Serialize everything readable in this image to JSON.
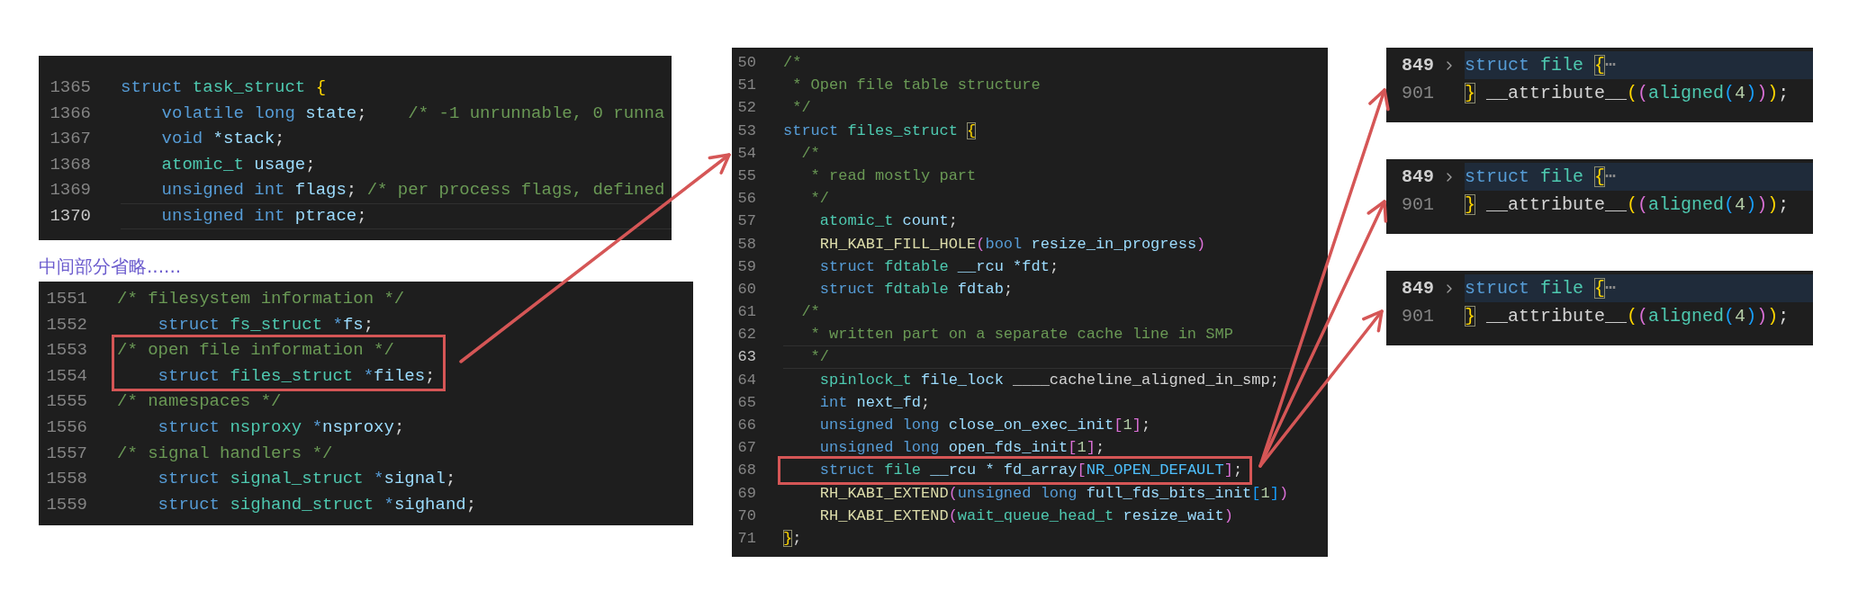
{
  "snippets": [
    {
      "lines": [
        {
          "number": "1365",
          "current": false,
          "boxed": false,
          "tokens": [
            {
              "text": "struct",
              "kind": "keyword"
            },
            {
              "text": " task_struct",
              "kind": "type"
            },
            {
              "text": " {",
              "kind": "bracket_gold"
            }
          ]
        },
        {
          "number": "1366",
          "current": false,
          "boxed": false,
          "tokens": [
            {
              "text": "    volatile long",
              "kind": "keyword"
            },
            {
              "text": " state",
              "kind": "variable"
            },
            {
              "text": ";",
              "kind": "punct"
            },
            {
              "text": "    /* -1 unrunnable, 0 runna",
              "kind": "comment"
            }
          ]
        },
        {
          "number": "1367",
          "current": false,
          "boxed": false,
          "tokens": [
            {
              "text": "    void",
              "kind": "keyword"
            },
            {
              "text": " *stack",
              "kind": "variable"
            },
            {
              "text": ";",
              "kind": "punct"
            }
          ]
        },
        {
          "number": "1368",
          "current": false,
          "boxed": false,
          "tokens": [
            {
              "text": "    atomic_t",
              "kind": "type"
            },
            {
              "text": " usage",
              "kind": "variable"
            },
            {
              "text": ";",
              "kind": "punct"
            }
          ]
        },
        {
          "number": "1369",
          "current": false,
          "boxed": false,
          "tokens": [
            {
              "text": "    unsigned int",
              "kind": "keyword"
            },
            {
              "text": " flags",
              "kind": "variable"
            },
            {
              "text": ";",
              "kind": "punct"
            },
            {
              "text": " /* per process flags, defined",
              "kind": "comment"
            }
          ]
        },
        {
          "number": "1370",
          "current": true,
          "boxed": false,
          "tokens": [
            {
              "text": "    unsigned int",
              "kind": "keyword"
            },
            {
              "text": " ptrace",
              "kind": "variable"
            },
            {
              "text": ";",
              "kind": "punct"
            }
          ]
        }
      ]
    },
    {
      "lines": [
        {
          "number": "1551",
          "current": false,
          "boxed": false,
          "tokens": [
            {
              "text": "/* filesystem information */",
              "kind": "comment"
            }
          ]
        },
        {
          "number": "1552",
          "current": false,
          "boxed": false,
          "tokens": [
            {
              "text": "    struct",
              "kind": "keyword"
            },
            {
              "text": " fs_struct",
              "kind": "type"
            },
            {
              "text": " *",
              "kind": "keyword"
            },
            {
              "text": "fs",
              "kind": "variable"
            },
            {
              "text": ";",
              "kind": "punct"
            }
          ]
        },
        {
          "number": "1553",
          "current": false,
          "boxed": true,
          "tokens": [
            {
              "text": "/* open file information */",
              "kind": "comment"
            }
          ]
        },
        {
          "number": "1554",
          "current": false,
          "boxed": true,
          "tokens": [
            {
              "text": "    struct",
              "kind": "keyword"
            },
            {
              "text": " files_struct",
              "kind": "type"
            },
            {
              "text": " *",
              "kind": "keyword"
            },
            {
              "text": "files",
              "kind": "variable"
            },
            {
              "text": ";",
              "kind": "punct"
            }
          ]
        },
        {
          "number": "1555",
          "current": false,
          "boxed": false,
          "tokens": [
            {
              "text": "/* namespaces */",
              "kind": "comment"
            }
          ]
        },
        {
          "number": "1556",
          "current": false,
          "boxed": false,
          "tokens": [
            {
              "text": "    struct",
              "kind": "keyword"
            },
            {
              "text": " nsproxy",
              "kind": "type"
            },
            {
              "text": " *",
              "kind": "keyword"
            },
            {
              "text": "nsproxy",
              "kind": "variable"
            },
            {
              "text": ";",
              "kind": "punct"
            }
          ]
        },
        {
          "number": "1557",
          "current": false,
          "boxed": false,
          "tokens": [
            {
              "text": "/* signal handlers */",
              "kind": "comment"
            }
          ]
        },
        {
          "number": "1558",
          "current": false,
          "boxed": false,
          "tokens": [
            {
              "text": "    struct",
              "kind": "keyword"
            },
            {
              "text": " signal_struct",
              "kind": "type"
            },
            {
              "text": " *",
              "kind": "keyword"
            },
            {
              "text": "signal",
              "kind": "variable"
            },
            {
              "text": ";",
              "kind": "punct"
            }
          ]
        },
        {
          "number": "1559",
          "current": false,
          "boxed": false,
          "tokens": [
            {
              "text": "    struct",
              "kind": "keyword"
            },
            {
              "text": " sighand_struct",
              "kind": "type"
            },
            {
              "text": " *",
              "kind": "keyword"
            },
            {
              "text": "sighand",
              "kind": "variable"
            },
            {
              "text": ";",
              "kind": "punct"
            }
          ]
        }
      ]
    },
    {
      "lines": [
        {
          "number": "50",
          "current": false,
          "boxed": false,
          "tokens": [
            {
              "text": "/*",
              "kind": "comment"
            }
          ]
        },
        {
          "number": "51",
          "current": false,
          "boxed": false,
          "tokens": [
            {
              "text": " * Open file table structure",
              "kind": "comment"
            }
          ]
        },
        {
          "number": "52",
          "current": false,
          "boxed": false,
          "tokens": [
            {
              "text": " */",
              "kind": "comment"
            }
          ]
        },
        {
          "number": "53",
          "current": false,
          "boxed": false,
          "tokens": [
            {
              "text": "struct",
              "kind": "keyword"
            },
            {
              "text": " files_struct ",
              "kind": "type"
            },
            {
              "text": "{",
              "kind": "bracket_match"
            }
          ]
        },
        {
          "number": "54",
          "current": false,
          "boxed": false,
          "tokens": [
            {
              "text": "  /*",
              "kind": "comment"
            }
          ]
        },
        {
          "number": "55",
          "current": false,
          "boxed": false,
          "tokens": [
            {
              "text": "   * read mostly part",
              "kind": "comment"
            }
          ]
        },
        {
          "number": "56",
          "current": false,
          "boxed": false,
          "tokens": [
            {
              "text": "   */",
              "kind": "comment"
            }
          ]
        },
        {
          "number": "57",
          "current": false,
          "boxed": false,
          "tokens": [
            {
              "text": "    atomic_t",
              "kind": "type"
            },
            {
              "text": " count",
              "kind": "variable"
            },
            {
              "text": ";",
              "kind": "punct"
            }
          ]
        },
        {
          "number": "58",
          "current": false,
          "boxed": false,
          "tokens": [
            {
              "text": "    RH_KABI_FILL_HOLE",
              "kind": "macro"
            },
            {
              "text": "(",
              "kind": "bracket_pink"
            },
            {
              "text": "bool",
              "kind": "keyword"
            },
            {
              "text": " resize_in_progress",
              "kind": "variable"
            },
            {
              "text": ")",
              "kind": "bracket_pink"
            }
          ]
        },
        {
          "number": "59",
          "current": false,
          "boxed": false,
          "tokens": [
            {
              "text": "    struct",
              "kind": "keyword"
            },
            {
              "text": " fdtable",
              "kind": "type"
            },
            {
              "text": " __rcu *fdt",
              "kind": "variable"
            },
            {
              "text": ";",
              "kind": "punct"
            }
          ]
        },
        {
          "number": "60",
          "current": false,
          "boxed": false,
          "tokens": [
            {
              "text": "    struct",
              "kind": "keyword"
            },
            {
              "text": " fdtable",
              "kind": "type"
            },
            {
              "text": " fdtab",
              "kind": "variable"
            },
            {
              "text": ";",
              "kind": "punct"
            }
          ]
        },
        {
          "number": "61",
          "current": false,
          "boxed": false,
          "tokens": [
            {
              "text": "  /*",
              "kind": "comment"
            }
          ]
        },
        {
          "number": "62",
          "current": false,
          "boxed": false,
          "tokens": [
            {
              "text": "   * written part on a separate cache line in SMP",
              "kind": "comment"
            }
          ]
        },
        {
          "number": "63",
          "current": true,
          "boxed": false,
          "tokens": [
            {
              "text": "   */",
              "kind": "comment"
            }
          ]
        },
        {
          "number": "64",
          "current": false,
          "boxed": false,
          "tokens": [
            {
              "text": "    spinlock_t",
              "kind": "type"
            },
            {
              "text": " file_lock",
              "kind": "variable"
            },
            {
              "text": " ____cacheline_aligned_in_smp",
              "kind": "plain"
            },
            {
              "text": ";",
              "kind": "punct"
            }
          ]
        },
        {
          "number": "65",
          "current": false,
          "boxed": false,
          "tokens": [
            {
              "text": "    int",
              "kind": "keyword"
            },
            {
              "text": " next_fd",
              "kind": "variable"
            },
            {
              "text": ";",
              "kind": "punct"
            }
          ]
        },
        {
          "number": "66",
          "current": false,
          "boxed": false,
          "tokens": [
            {
              "text": "    unsigned long",
              "kind": "keyword"
            },
            {
              "text": " close_on_exec_init",
              "kind": "variable"
            },
            {
              "text": "[",
              "kind": "bracket_pink"
            },
            {
              "text": "1",
              "kind": "number"
            },
            {
              "text": "]",
              "kind": "bracket_pink"
            },
            {
              "text": ";",
              "kind": "punct"
            }
          ]
        },
        {
          "number": "67",
          "current": false,
          "boxed": false,
          "tokens": [
            {
              "text": "    unsigned long",
              "kind": "keyword"
            },
            {
              "text": " open_fds_init",
              "kind": "variable"
            },
            {
              "text": "[",
              "kind": "bracket_pink"
            },
            {
              "text": "1",
              "kind": "number"
            },
            {
              "text": "]",
              "kind": "bracket_pink"
            },
            {
              "text": ";",
              "kind": "punct"
            }
          ]
        },
        {
          "number": "68",
          "current": false,
          "boxed": true,
          "tokens": [
            {
              "text": "    struct",
              "kind": "keyword"
            },
            {
              "text": " file",
              "kind": "type"
            },
            {
              "text": " __rcu * fd_array",
              "kind": "variable"
            },
            {
              "text": "[",
              "kind": "bracket_pink"
            },
            {
              "text": "NR_OPEN_DEFAULT",
              "kind": "const"
            },
            {
              "text": "]",
              "kind": "bracket_pink"
            },
            {
              "text": ";",
              "kind": "punct"
            }
          ]
        },
        {
          "number": "69",
          "current": false,
          "boxed": false,
          "tokens": [
            {
              "text": "    RH_KABI_EXTEND",
              "kind": "macro"
            },
            {
              "text": "(",
              "kind": "bracket_pink"
            },
            {
              "text": "unsigned long",
              "kind": "keyword"
            },
            {
              "text": " full_fds_bits_init",
              "kind": "variable"
            },
            {
              "text": "[",
              "kind": "bracket_blue"
            },
            {
              "text": "1",
              "kind": "number"
            },
            {
              "text": "]",
              "kind": "bracket_blue"
            },
            {
              "text": ")",
              "kind": "bracket_pink"
            }
          ]
        },
        {
          "number": "70",
          "current": false,
          "boxed": false,
          "tokens": [
            {
              "text": "    RH_KABI_EXTEND",
              "kind": "macro"
            },
            {
              "text": "(",
              "kind": "bracket_pink"
            },
            {
              "text": "wait_queue_head_t",
              "kind": "type"
            },
            {
              "text": " resize_wait",
              "kind": "variable"
            },
            {
              "text": ")",
              "kind": "bracket_pink"
            }
          ]
        },
        {
          "number": "71",
          "current": false,
          "boxed": false,
          "tokens": [
            {
              "text": "}",
              "kind": "bracket_match"
            },
            {
              "text": ";",
              "kind": "punct"
            }
          ]
        }
      ]
    },
    {
      "lines": [
        {
          "number": "849",
          "current": true,
          "boxed": false,
          "folded": true,
          "tokens": [
            {
              "text": "struct",
              "kind": "keyword"
            },
            {
              "text": " file ",
              "kind": "type"
            },
            {
              "text": "{",
              "kind": "bracket_match"
            },
            {
              "text": "⋯",
              "kind": "fold"
            }
          ]
        },
        {
          "number": "901",
          "current": false,
          "boxed": false,
          "folded": false,
          "tokens": [
            {
              "text": "}",
              "kind": "bracket_match"
            },
            {
              "text": " __attribute__",
              "kind": "plain"
            },
            {
              "text": "(",
              "kind": "bracket_gold"
            },
            {
              "text": "(",
              "kind": "bracket_pink"
            },
            {
              "text": "aligned",
              "kind": "type"
            },
            {
              "text": "(",
              "kind": "bracket_blue"
            },
            {
              "text": "4",
              "kind": "number"
            },
            {
              "text": ")",
              "kind": "bracket_blue"
            },
            {
              "text": ")",
              "kind": "bracket_pink"
            },
            {
              "text": ")",
              "kind": "bracket_gold"
            },
            {
              "text": ";",
              "kind": "punct"
            }
          ]
        }
      ]
    },
    {
      "lines": [
        {
          "number": "849",
          "current": true,
          "boxed": false,
          "folded": true,
          "tokens": [
            {
              "text": "struct",
              "kind": "keyword"
            },
            {
              "text": " file ",
              "kind": "type"
            },
            {
              "text": "{",
              "kind": "bracket_match"
            },
            {
              "text": "⋯",
              "kind": "fold"
            }
          ]
        },
        {
          "number": "901",
          "current": false,
          "boxed": false,
          "folded": false,
          "tokens": [
            {
              "text": "}",
              "kind": "bracket_match"
            },
            {
              "text": " __attribute__",
              "kind": "plain"
            },
            {
              "text": "(",
              "kind": "bracket_gold"
            },
            {
              "text": "(",
              "kind": "bracket_pink"
            },
            {
              "text": "aligned",
              "kind": "type"
            },
            {
              "text": "(",
              "kind": "bracket_blue"
            },
            {
              "text": "4",
              "kind": "number"
            },
            {
              "text": ")",
              "kind": "bracket_blue"
            },
            {
              "text": ")",
              "kind": "bracket_pink"
            },
            {
              "text": ")",
              "kind": "bracket_gold"
            },
            {
              "text": ";",
              "kind": "punct"
            }
          ]
        }
      ]
    },
    {
      "lines": [
        {
          "number": "849",
          "current": true,
          "boxed": false,
          "folded": true,
          "tokens": [
            {
              "text": "struct",
              "kind": "keyword"
            },
            {
              "text": " file ",
              "kind": "type"
            },
            {
              "text": "{",
              "kind": "bracket_match"
            },
            {
              "text": "⋯",
              "kind": "fold"
            }
          ]
        },
        {
          "number": "901",
          "current": false,
          "boxed": false,
          "folded": false,
          "tokens": [
            {
              "text": "}",
              "kind": "bracket_match"
            },
            {
              "text": " __attribute__",
              "kind": "plain"
            },
            {
              "text": "(",
              "kind": "bracket_gold"
            },
            {
              "text": "(",
              "kind": "bracket_pink"
            },
            {
              "text": "aligned",
              "kind": "type"
            },
            {
              "text": "(",
              "kind": "bracket_blue"
            },
            {
              "text": "4",
              "kind": "number"
            },
            {
              "text": ")",
              "kind": "bracket_blue"
            },
            {
              "text": ")",
              "kind": "bracket_pink"
            },
            {
              "text": ")",
              "kind": "bracket_gold"
            },
            {
              "text": ";",
              "kind": "punct"
            }
          ]
        }
      ]
    }
  ],
  "caption": "中间部分省略......"
}
